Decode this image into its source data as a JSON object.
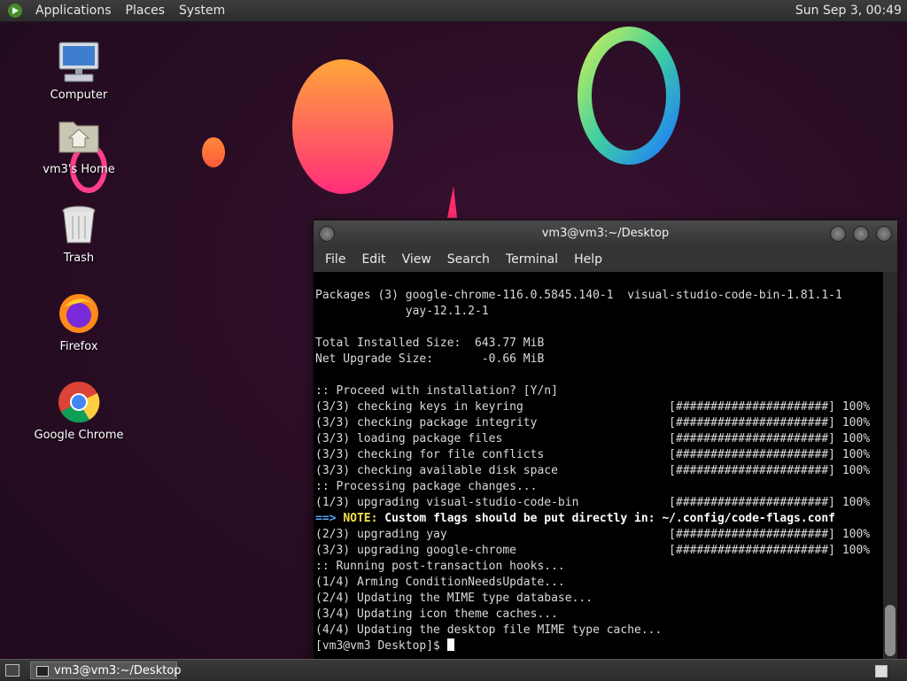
{
  "top_panel": {
    "menus": [
      "Applications",
      "Places",
      "System"
    ],
    "clock": "Sun Sep  3, 00:49"
  },
  "desktop_icons": [
    {
      "label": "Computer",
      "icon": "computer-icon"
    },
    {
      "label": "vm3's Home",
      "icon": "home-folder-icon"
    },
    {
      "label": "Trash",
      "icon": "trash-icon"
    },
    {
      "label": "Firefox",
      "icon": "firefox-icon"
    },
    {
      "label": "Google Chrome",
      "icon": "chrome-icon"
    }
  ],
  "terminal": {
    "title": "vm3@vm3:~/Desktop",
    "menu": [
      "File",
      "Edit",
      "View",
      "Search",
      "Terminal",
      "Help"
    ],
    "lines": [
      "Packages (3) google-chrome-116.0.5845.140-1  visual-studio-code-bin-1.81.1-1",
      "             yay-12.1.2-1",
      "",
      "Total Installed Size:  643.77 MiB",
      "Net Upgrade Size:       -0.66 MiB",
      "",
      ":: Proceed with installation? [Y/n]",
      "(3/3) checking keys in keyring                     [######################] 100%",
      "(3/3) checking package integrity                   [######################] 100%",
      "(3/3) loading package files                        [######################] 100%",
      "(3/3) checking for file conflicts                  [######################] 100%",
      "(3/3) checking available disk space                [######################] 100%",
      ":: Processing package changes...",
      "(1/3) upgrading visual-studio-code-bin             [######################] 100%",
      "==> NOTE: Custom flags should be put directly in: ~/.config/code-flags.conf",
      "(2/3) upgrading yay                                [######################] 100%",
      "(3/3) upgrading google-chrome                      [######################] 100%",
      ":: Running post-transaction hooks...",
      "(1/4) Arming ConditionNeedsUpdate...",
      "(2/4) Updating the MIME type database...",
      "(3/4) Updating icon theme caches...",
      "(4/4) Updating the desktop file MIME type cache...",
      "[vm3@vm3 Desktop]$ "
    ],
    "note_line": {
      "arrow": "==>",
      "note": "NOTE:",
      "text": " Custom flags should be put directly in: ~/.config/code-flags.conf"
    }
  },
  "taskbar": {
    "window_button": "vm3@vm3:~/Desktop"
  },
  "colors": {
    "wallpaper": "#2a0d25",
    "terminal_bg": "#000000",
    "note_yellow": "#f5e04a",
    "arrow_blue": "#55aaff"
  }
}
